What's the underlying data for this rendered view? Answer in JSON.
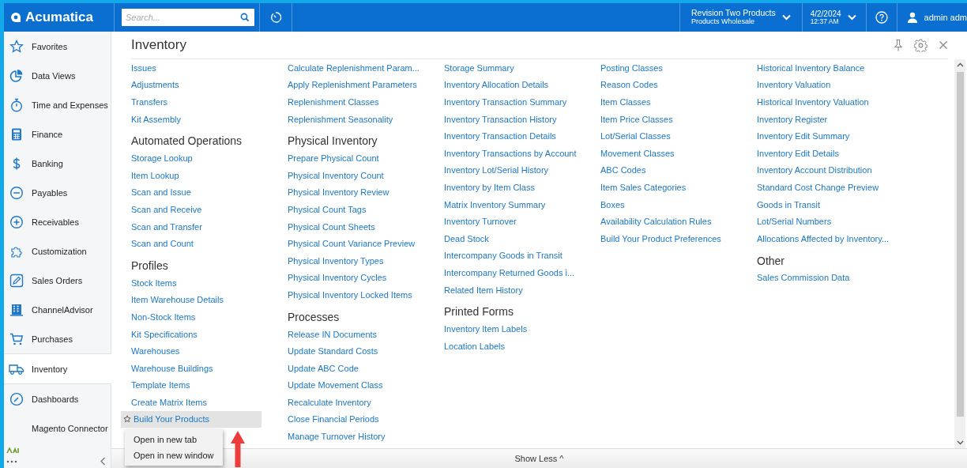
{
  "topbar": {
    "logo": "Acumatica",
    "search": {
      "placeholder": "Search..."
    },
    "company": {
      "line1": "Revision Two Products",
      "line2": "Products Wholesale"
    },
    "date": {
      "line1": "4/2/2024",
      "line2": "12:37 AM"
    },
    "user": "admin adm"
  },
  "sidebar": {
    "items": [
      {
        "label": "Favorites",
        "selected": false
      },
      {
        "label": "Data Views",
        "selected": false
      },
      {
        "label": "Time and Expenses",
        "selected": false
      },
      {
        "label": "Finance",
        "selected": false
      },
      {
        "label": "Banking",
        "selected": false
      },
      {
        "label": "Payables",
        "selected": false
      },
      {
        "label": "Receivables",
        "selected": false
      },
      {
        "label": "Customization",
        "selected": false
      },
      {
        "label": "Sales Orders",
        "selected": false
      },
      {
        "label": "ChannelAdvisor",
        "selected": false
      },
      {
        "label": "Purchases",
        "selected": false
      },
      {
        "label": "Inventory",
        "selected": true
      },
      {
        "label": "Dashboards",
        "selected": false
      },
      {
        "label": "Magento Connector",
        "selected": false
      }
    ]
  },
  "panel": {
    "title": "Inventory",
    "footer": "Show Less ^",
    "columns": [
      [
        {
          "kind": "link",
          "label": "Issues"
        },
        {
          "kind": "link",
          "label": "Adjustments"
        },
        {
          "kind": "link",
          "label": "Transfers"
        },
        {
          "kind": "link",
          "label": "Kit Assembly"
        },
        {
          "kind": "heading",
          "label": "Automated Operations"
        },
        {
          "kind": "link",
          "label": "Storage Lookup"
        },
        {
          "kind": "link",
          "label": "Item Lookup"
        },
        {
          "kind": "link",
          "label": "Scan and Issue"
        },
        {
          "kind": "link",
          "label": "Scan and Receive"
        },
        {
          "kind": "link",
          "label": "Scan and Transfer"
        },
        {
          "kind": "link",
          "label": "Scan and Count"
        },
        {
          "kind": "heading",
          "label": "Profiles"
        },
        {
          "kind": "link",
          "label": "Stock Items"
        },
        {
          "kind": "link",
          "label": "Item Warehouse Details"
        },
        {
          "kind": "link",
          "label": "Non-Stock Items"
        },
        {
          "kind": "link",
          "label": "Kit Specifications"
        },
        {
          "kind": "link",
          "label": "Warehouses"
        },
        {
          "kind": "link",
          "label": "Warehouse Buildings"
        },
        {
          "kind": "link",
          "label": "Template Items"
        },
        {
          "kind": "link",
          "label": "Create Matrix Items"
        },
        {
          "kind": "hovered",
          "label": "Build Your Products"
        }
      ],
      [
        {
          "kind": "link",
          "label": "Calculate Replenishment Param..."
        },
        {
          "kind": "link",
          "label": "Apply Replenishment Parameters"
        },
        {
          "kind": "link",
          "label": "Replenishment Classes"
        },
        {
          "kind": "link",
          "label": "Replenishment Seasonality"
        },
        {
          "kind": "heading",
          "label": "Physical Inventory"
        },
        {
          "kind": "link",
          "label": "Prepare Physical Count"
        },
        {
          "kind": "link",
          "label": "Physical Inventory Count"
        },
        {
          "kind": "link",
          "label": "Physical Inventory Review"
        },
        {
          "kind": "link",
          "label": "Physical Count Tags"
        },
        {
          "kind": "link",
          "label": "Physical Count Sheets"
        },
        {
          "kind": "link",
          "label": "Physical Count Variance Preview"
        },
        {
          "kind": "link",
          "label": "Physical Inventory Types"
        },
        {
          "kind": "link",
          "label": "Physical Inventory Cycles"
        },
        {
          "kind": "link",
          "label": "Physical Inventory Locked Items"
        },
        {
          "kind": "heading",
          "label": "Processes"
        },
        {
          "kind": "link",
          "label": "Release IN Documents"
        },
        {
          "kind": "link",
          "label": "Update Standard Costs"
        },
        {
          "kind": "link",
          "label": "Update ABC Code"
        },
        {
          "kind": "link",
          "label": "Update Movement Class"
        },
        {
          "kind": "link",
          "label": "Recalculate Inventory"
        },
        {
          "kind": "link",
          "label": "Close Financial Periods"
        },
        {
          "kind": "link",
          "label": "Manage Turnover History"
        }
      ],
      [
        {
          "kind": "link",
          "label": "Storage Summary"
        },
        {
          "kind": "link",
          "label": "Inventory Allocation Details"
        },
        {
          "kind": "link",
          "label": "Inventory Transaction Summary"
        },
        {
          "kind": "link",
          "label": "Inventory Transaction History"
        },
        {
          "kind": "link",
          "label": "Inventory Transaction Details"
        },
        {
          "kind": "link",
          "label": "Inventory Transactions by Account"
        },
        {
          "kind": "link",
          "label": "Inventory Lot/Serial History"
        },
        {
          "kind": "link",
          "label": "Inventory by Item Class"
        },
        {
          "kind": "link",
          "label": "Matrix Inventory Summary"
        },
        {
          "kind": "link",
          "label": "Inventory Turnover"
        },
        {
          "kind": "link",
          "label": "Dead Stock"
        },
        {
          "kind": "link",
          "label": "Intercompany Goods in Transit"
        },
        {
          "kind": "link",
          "label": "Intercompany Returned Goods i..."
        },
        {
          "kind": "link",
          "label": "Related Item History"
        },
        {
          "kind": "heading",
          "label": "Printed Forms"
        },
        {
          "kind": "link",
          "label": "Inventory Item Labels"
        },
        {
          "kind": "link",
          "label": "Location Labels"
        }
      ],
      [
        {
          "kind": "link",
          "label": "Posting Classes"
        },
        {
          "kind": "link",
          "label": "Reason Codes"
        },
        {
          "kind": "link",
          "label": "Item Classes"
        },
        {
          "kind": "link",
          "label": "Item Price Classes"
        },
        {
          "kind": "link",
          "label": "Lot/Serial Classes"
        },
        {
          "kind": "link",
          "label": "Movement Classes"
        },
        {
          "kind": "link",
          "label": "ABC Codes"
        },
        {
          "kind": "link",
          "label": "Item Sales Categories"
        },
        {
          "kind": "link",
          "label": "Boxes"
        },
        {
          "kind": "link",
          "label": "Availability Calculation Rules"
        },
        {
          "kind": "link",
          "label": "Build Your Product Preferences"
        }
      ],
      [
        {
          "kind": "link",
          "label": "Historical Inventory Balance"
        },
        {
          "kind": "link",
          "label": "Inventory Valuation"
        },
        {
          "kind": "link",
          "label": "Historical Inventory Valuation"
        },
        {
          "kind": "link",
          "label": "Inventory Register"
        },
        {
          "kind": "link",
          "label": "Inventory Edit Summary"
        },
        {
          "kind": "link",
          "label": "Inventory Edit Details"
        },
        {
          "kind": "link",
          "label": "Inventory Account Distribution"
        },
        {
          "kind": "link",
          "label": "Standard Cost Change Preview"
        },
        {
          "kind": "link",
          "label": "Goods in Transit"
        },
        {
          "kind": "link",
          "label": "Lot/Serial Numbers"
        },
        {
          "kind": "link",
          "label": "Allocations Affected by Inventory..."
        },
        {
          "kind": "heading",
          "label": "Other"
        },
        {
          "kind": "link",
          "label": "Sales Commission Data"
        }
      ]
    ]
  },
  "context_menu": {
    "items": [
      "Open in new tab",
      "Open in new window"
    ]
  }
}
